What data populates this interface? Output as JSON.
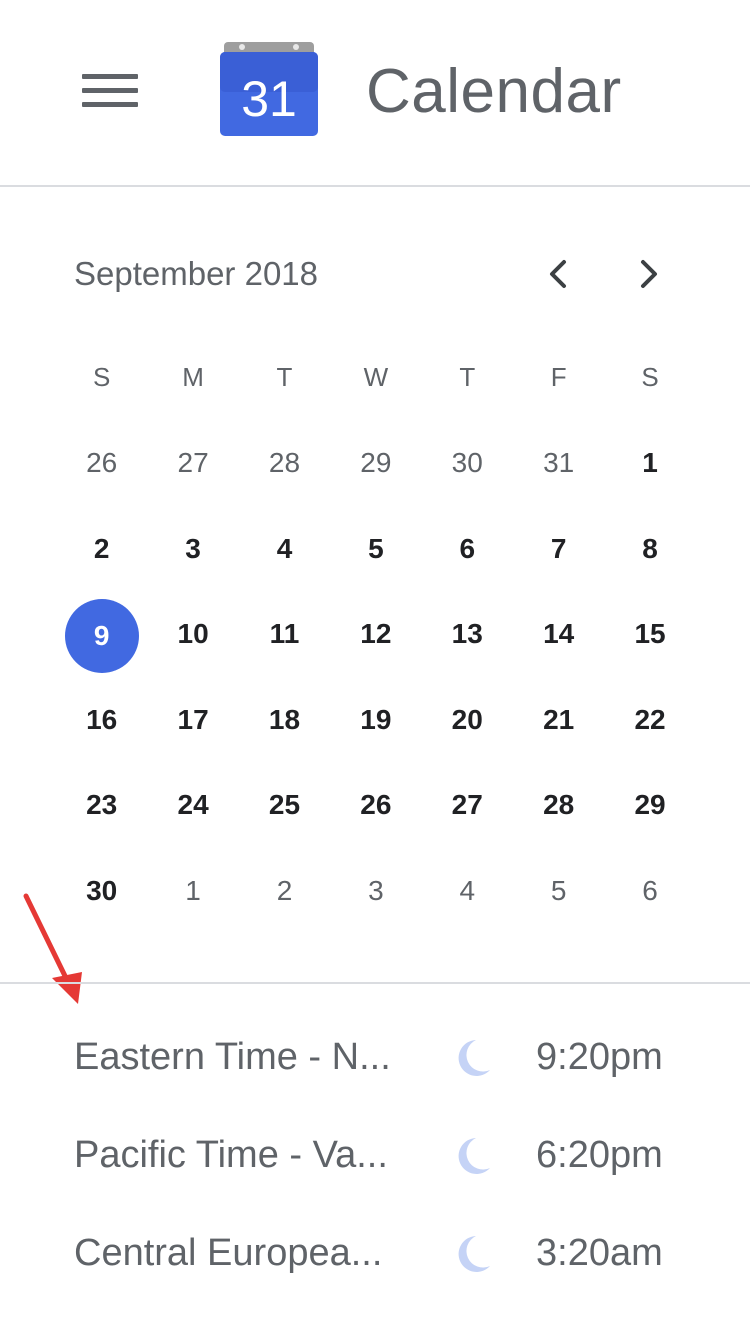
{
  "header": {
    "title": "Calendar",
    "logo_number": "31",
    "menu_icon": "hamburger-menu-icon"
  },
  "month_nav": {
    "label": "September 2018",
    "prev_icon": "chevron-left-icon",
    "next_icon": "chevron-right-icon"
  },
  "calendar": {
    "weekdays": [
      "S",
      "M",
      "T",
      "W",
      "T",
      "F",
      "S"
    ],
    "weeks": [
      [
        {
          "d": "26",
          "m": "other"
        },
        {
          "d": "27",
          "m": "other"
        },
        {
          "d": "28",
          "m": "other"
        },
        {
          "d": "29",
          "m": "other"
        },
        {
          "d": "30",
          "m": "other"
        },
        {
          "d": "31",
          "m": "other"
        },
        {
          "d": "1",
          "m": "cur"
        }
      ],
      [
        {
          "d": "2",
          "m": "cur"
        },
        {
          "d": "3",
          "m": "cur"
        },
        {
          "d": "4",
          "m": "cur"
        },
        {
          "d": "5",
          "m": "cur"
        },
        {
          "d": "6",
          "m": "cur"
        },
        {
          "d": "7",
          "m": "cur"
        },
        {
          "d": "8",
          "m": "cur"
        }
      ],
      [
        {
          "d": "9",
          "m": "today"
        },
        {
          "d": "10",
          "m": "cur"
        },
        {
          "d": "11",
          "m": "cur"
        },
        {
          "d": "12",
          "m": "cur"
        },
        {
          "d": "13",
          "m": "cur"
        },
        {
          "d": "14",
          "m": "cur"
        },
        {
          "d": "15",
          "m": "cur"
        }
      ],
      [
        {
          "d": "16",
          "m": "cur"
        },
        {
          "d": "17",
          "m": "cur"
        },
        {
          "d": "18",
          "m": "cur"
        },
        {
          "d": "19",
          "m": "cur"
        },
        {
          "d": "20",
          "m": "cur"
        },
        {
          "d": "21",
          "m": "cur"
        },
        {
          "d": "22",
          "m": "cur"
        }
      ],
      [
        {
          "d": "23",
          "m": "cur"
        },
        {
          "d": "24",
          "m": "cur"
        },
        {
          "d": "25",
          "m": "cur"
        },
        {
          "d": "26",
          "m": "cur"
        },
        {
          "d": "27",
          "m": "cur"
        },
        {
          "d": "28",
          "m": "cur"
        },
        {
          "d": "29",
          "m": "cur"
        }
      ],
      [
        {
          "d": "30",
          "m": "cur"
        },
        {
          "d": "1",
          "m": "other"
        },
        {
          "d": "2",
          "m": "other"
        },
        {
          "d": "3",
          "m": "other"
        },
        {
          "d": "4",
          "m": "other"
        },
        {
          "d": "5",
          "m": "other"
        },
        {
          "d": "6",
          "m": "other"
        }
      ]
    ],
    "today_color": "#4169e1"
  },
  "timezones": [
    {
      "name": "Eastern Time - N...",
      "icon": "moon-icon",
      "time": "9:20pm"
    },
    {
      "name": "Pacific Time - Va...",
      "icon": "moon-icon",
      "time": "6:20pm"
    },
    {
      "name": "Central Europea...",
      "icon": "moon-icon",
      "time": "3:20am"
    }
  ],
  "colors": {
    "logo_blue": "#4169e1",
    "annotation_red": "#e53935",
    "moon": "#c5d3f6"
  }
}
